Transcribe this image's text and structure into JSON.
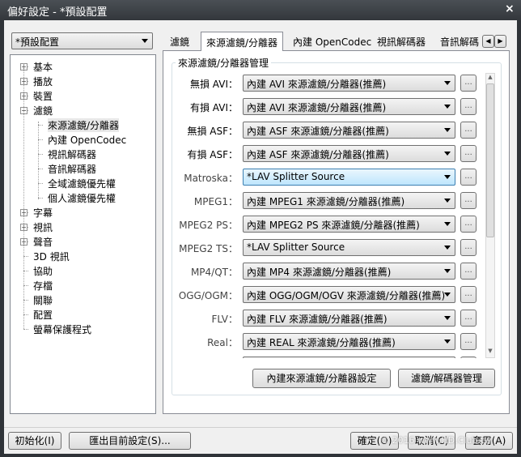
{
  "window": {
    "title": "偏好設定 - *預設配置",
    "close": "×"
  },
  "profile": {
    "value": "*預設配置"
  },
  "tree": [
    {
      "label": "基本",
      "pm": "+",
      "level": 0
    },
    {
      "label": "播放",
      "pm": "+",
      "level": 0
    },
    {
      "label": "裝置",
      "pm": "+",
      "level": 0
    },
    {
      "label": "濾鏡",
      "pm": "−",
      "level": 0
    },
    {
      "label": "來源濾鏡/分離器",
      "level": 1,
      "selected": true
    },
    {
      "label": "內建 OpenCodec",
      "level": 1
    },
    {
      "label": "視訊解碼器",
      "level": 1
    },
    {
      "label": "音訊解碼器",
      "level": 1
    },
    {
      "label": "全域濾鏡優先權",
      "level": 1
    },
    {
      "label": "個人濾鏡優先權",
      "level": 1
    },
    {
      "label": "字幕",
      "pm": "+",
      "level": 0
    },
    {
      "label": "視訊",
      "pm": "+",
      "level": 0
    },
    {
      "label": "聲音",
      "pm": "+",
      "level": 0
    },
    {
      "label": "3D 視訊",
      "level": 0
    },
    {
      "label": "協助",
      "level": 0
    },
    {
      "label": "存檔",
      "level": 0
    },
    {
      "label": "關聯",
      "level": 0
    },
    {
      "label": "配置",
      "level": 0
    },
    {
      "label": "螢幕保護程式",
      "level": 0
    }
  ],
  "tabs": [
    "濾鏡",
    "來源濾鏡/分離器",
    "內建 OpenCodec",
    "視訊解碼器",
    "音訊解碼"
  ],
  "group_title": "來源濾鏡/分離器管理",
  "rows": [
    {
      "label": "無損 AVI：",
      "value": "內建 AVI 來源濾鏡/分離器(推薦)"
    },
    {
      "label": "有損 AVI：",
      "value": "內建 AVI 來源濾鏡/分離器(推薦)"
    },
    {
      "label": "無損 ASF：",
      "value": "內建 ASF 來源濾鏡/分離器(推薦)"
    },
    {
      "label": "有損 ASF：",
      "value": "內建 ASF 來源濾鏡/分離器(推薦)"
    },
    {
      "label": "Matroska：",
      "value": "*LAV Splitter Source",
      "highlight": true
    },
    {
      "label": "MPEG1：",
      "value": "內建 MPEG1 來源濾鏡/分離器(推薦)"
    },
    {
      "label": "MPEG2 PS：",
      "value": "內建 MPEG2 PS 來源濾鏡/分離器(推薦)"
    },
    {
      "label": "MPEG2 TS：",
      "value": "*LAV Splitter Source"
    },
    {
      "label": "MP4/QT：",
      "value": "內建 MP4 來源濾鏡/分離器(推薦)"
    },
    {
      "label": "OGG/OGM：",
      "value": "內建 OGG/OGM/OGV 來源濾鏡/分離器(推薦)"
    },
    {
      "label": "FLV：",
      "value": "內建 FLV 來源濾鏡/分離器(推薦)"
    },
    {
      "label": "Real：",
      "value": "內建 REAL 來源濾鏡/分離器(推薦)"
    },
    {
      "label": "",
      "value": ""
    }
  ],
  "more_label": "...",
  "buttons": {
    "builtin_settings": "內建來源濾鏡/分離器設定",
    "filter_manager": "濾鏡/解碼器管理",
    "init": "初始化(I)",
    "export": "匯出目前設定(S)...",
    "ok": "確定(O)",
    "cancel": "取消(C)",
    "apply": "套用(A)"
  },
  "watermark": "© 2016 www.HD.Club.tw"
}
